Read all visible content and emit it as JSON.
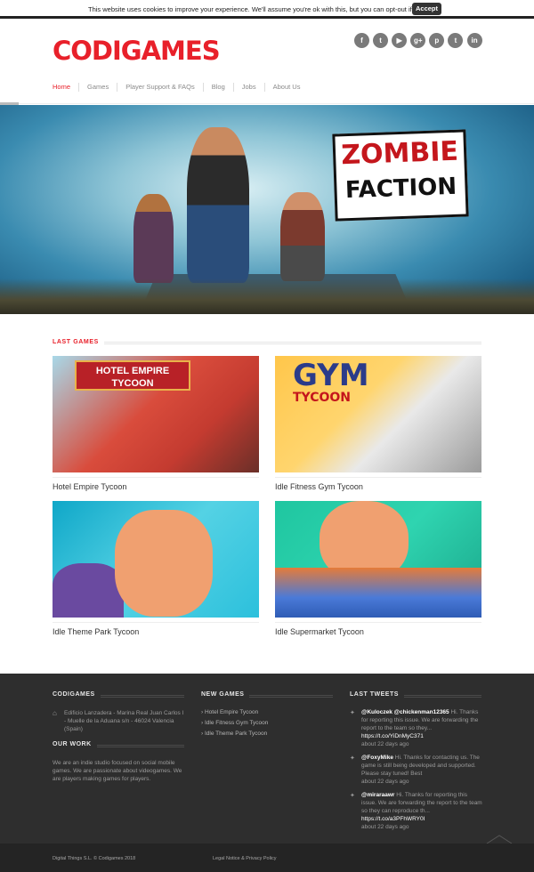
{
  "cookie": {
    "message": "This website uses cookies to improve your experience. We'll assume you're ok with this, but you can opt-out if you wish.",
    "accept_label": "Accept"
  },
  "header": {
    "logo": "CODIGAMES",
    "social": [
      "f",
      "t",
      "▶",
      "g+",
      "p",
      "t",
      "in"
    ],
    "nav": [
      "Home",
      "Games",
      "Player Support & FAQs",
      "Blog",
      "Jobs",
      "About Us"
    ]
  },
  "hero": {
    "logo_line1": "ZOMBIE",
    "logo_line2": "FACTION"
  },
  "games": {
    "section_title": "LAST GAMES",
    "items": [
      {
        "title": "Hotel Empire Tycoon",
        "sign": "HOTEL EMPIRE TYCOON"
      },
      {
        "title": "Idle Fitness Gym Tycoon",
        "sign": "GYM",
        "sign_sub": "TYCOON"
      },
      {
        "title": "Idle Theme Park Tycoon"
      },
      {
        "title": "Idle Supermarket Tycoon"
      }
    ]
  },
  "footer": {
    "codigames": {
      "title": "CODIGAMES",
      "address": "Edificio Lanzadera - Marina Real Juan Carlos I - Muelle de la Aduana s/n - 46024 Valencia (Spain)"
    },
    "our_work": {
      "title": "OUR WORK",
      "text": "We are an indie studio focused on social mobile games. We are passionate about videogames. We are players making games for players."
    },
    "new_games": {
      "title": "NEW GAMES",
      "links": [
        "Hotel Empire Tycoon",
        "Idle Fitness Gym Tycoon",
        "Idle Theme Park Tycoon"
      ]
    },
    "tweets": {
      "title": "LAST TWEETS",
      "items": [
        {
          "user": "@Kuloczek @chickenman12365",
          "text": " Hi. Thanks for reporting this issue. We are forwarding the report to the team so they... ",
          "link": "https://t.co/YiDnMyC371",
          "time": "about 22 days ago"
        },
        {
          "user": "@FoxyMike",
          "text": " Hi. Thanks for contacting us. The game is still being developed and supported. Please stay tuned! Best",
          "link": "",
          "time": "about 22 days ago"
        },
        {
          "user": "@miraraawr",
          "text": " Hi. Thanks for reporting this issue. We are forwarding the report to the team so they can reproduce th... ",
          "link": "https://t.co/a3PFhWRY0I",
          "time": "about 22 days ago"
        }
      ]
    },
    "copyright": "Digital Things S.L. © Codigames 2018",
    "legal": "Legal Notice & Privacy Policy"
  },
  "colors": {
    "brand_red": "#e8202a",
    "footer_bg": "#2e2e2e",
    "bottom_bar_bg": "#242424"
  }
}
